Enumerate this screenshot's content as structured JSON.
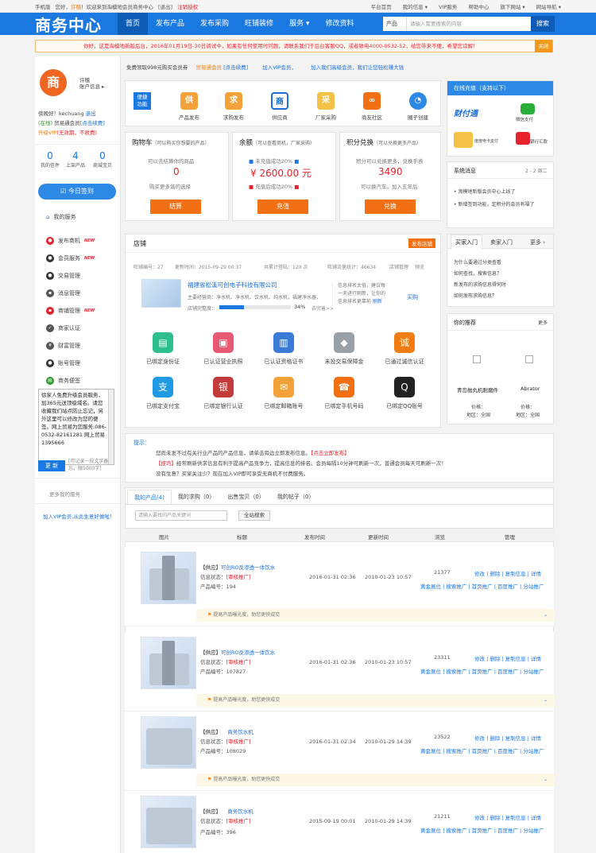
{
  "topbar": {
    "mobile": "手机版",
    "greet": "您好，",
    "user": "许稽",
    "welcome": "欢迎来到淘模地会员商务中心",
    "logout": "[退出]",
    "cancel": "注销授权",
    "links": [
      "平台首页",
      "我的信息 ▾",
      "VIP服务",
      "帮助中心",
      "旗下网站 ▾",
      "网站导航 ▾"
    ]
  },
  "nav": {
    "logo": "商务中心",
    "items": [
      "首页",
      "发布产品",
      "发布采购",
      "旺铺装修",
      "服务 ▾",
      "修改资料"
    ],
    "search_scope": "产品",
    "search_placeholder": "请输入需要搜索的内容",
    "search_btn": "搜索"
  },
  "notice": {
    "text": "你好，这是淘模地新版后台，2016年01月19日-30日调试中，如果有任何使用时问题，请联系我们于后台客服QQ，或者致电4000-0532-52，给您带来不便，希望您谅解！",
    "close": "关闭"
  },
  "profile": {
    "avatar": "商",
    "name": "许稽",
    "menu": "账户信息 ▸",
    "hello": "傍晚好！kechuang",
    "exit": "退出",
    "online": "(在线)",
    "level": "贸易通会员",
    "renew": "[点击续费]",
    "vip": "升级VIP",
    "noneline": "(无效期，不收费)",
    "stats": [
      {
        "n": "0",
        "t": "我的信件"
      },
      {
        "n": "4",
        "t": "上架产品"
      },
      {
        "n": "0",
        "t": "商城宝贝"
      }
    ],
    "sign": "今日签到",
    "myservice": "我的服务"
  },
  "menu": [
    {
      "label": "发布商机",
      "hot": "NEW"
    },
    {
      "label": "会员服务",
      "hot": "NEW"
    },
    {
      "label": "交易管理",
      "hot": ""
    },
    {
      "label": "消息管理",
      "hot": ""
    },
    {
      "label": "商铺管理",
      "hot": "NEW"
    },
    {
      "label": "商家认证",
      "hot": ""
    },
    {
      "label": "财富管理",
      "hot": ""
    },
    {
      "label": "账号管理",
      "hot": ""
    },
    {
      "label": "商务便签",
      "hot": ""
    }
  ],
  "memo": {
    "text": "徐家人免费升级会员服务，加365元送顶级域名。请您收藏我们站点防止忘记，另外这里可以修改为您的便签。网上贸易为您服务:086-0532-82161281 网上贸易 1395666",
    "update": "更 新",
    "hint": "[可记录一段文字备忘，限5000字]",
    "more": "更多我的服务",
    "vip_tip": "加入VIP会员,从此生意好做啦！"
  },
  "promo": {
    "a": "免费领取998元购买会员券",
    "b": "贸易通会员",
    "c": "[点击续费]",
    "d": "加入VIP会员，",
    "e": "加入我们高级会员，我们让您轻松赚大钱"
  },
  "quick": {
    "title": "便捷功能",
    "items": [
      {
        "label": "产品发布",
        "ch": "供",
        "color": "#f3a23a"
      },
      {
        "label": "求购发布",
        "ch": "求",
        "color": "#f3a23a"
      },
      {
        "label": "供应商",
        "ch": "商",
        "color": "#1a6fd8"
      },
      {
        "label": "厂家采购",
        "ch": "采",
        "color": "#f3c247"
      },
      {
        "label": "商友社区",
        "ch": "∞",
        "color": "#f36f14"
      },
      {
        "label": "圈子创建",
        "ch": "◔",
        "color": "#2d89e6"
      }
    ]
  },
  "cart": {
    "title": "购物车",
    "sub": "（可以购买你想要的产品）",
    "line1": "可以去结算你的商品",
    "num": "0",
    "line2": "购买更多谐的选择",
    "btn": "结算"
  },
  "balance": {
    "title": "余额",
    "sub": "（可以查看商机，厂家采购）",
    "a": "未充值成功20%",
    "amount": "¥ 2600.00 元",
    "b": "充值后成功20%",
    "btn": "充值"
  },
  "points": {
    "title": "积分兑换",
    "sub": "（可以兑换更多产品）",
    "line1": "积分可以兑换更多，兑换手表",
    "num": "3490",
    "line2": "可以换汽车，加入五年后",
    "btn": "兑换"
  },
  "shop": {
    "title": "店铺",
    "btn": "发布店铺",
    "info": [
      "旺铺编号：27",
      "更新时间：2015-09-29 00:37",
      "共累计登陆：120 次",
      "旺铺流量统计：46634",
      "店铺管理",
      "预览"
    ],
    "company": "福建省松溪可创电子科技有限公司",
    "main": "主要经营商：净水机、净水机、饮水机、纯水机，福建净水器，",
    "progress_label": "店铺完整度：",
    "progress": "34%",
    "progress_val": 34,
    "improve": "去完善>>",
    "rank": "信息排名太低，建议每一天进行刷新，让你的信息排名更靠前",
    "refresh": "刷新",
    "buy": "买购"
  },
  "certs": [
    {
      "label": "已绑定身份证",
      "color": "#2fbf8f",
      "ch": "▤"
    },
    {
      "label": "已认证营业执照",
      "color": "#e85a73",
      "ch": "▣"
    },
    {
      "label": "已认证资格证书",
      "color": "#3a7bd8",
      "ch": "▥"
    },
    {
      "label": "未投交易保障金",
      "color": "#9aa0a8",
      "ch": "◆"
    },
    {
      "label": "已通过诚信认证",
      "color": "#f07d12",
      "ch": "诚"
    },
    {
      "label": "已绑定支付宝",
      "color": "#1f9be6",
      "ch": "支"
    },
    {
      "label": "已绑定银行认证",
      "color": "#c23a3a",
      "ch": "银"
    },
    {
      "label": "已绑定邮箱账号",
      "color": "#f3a23a",
      "ch": "✉"
    },
    {
      "label": "已绑定手机号码",
      "color": "#f36f14",
      "ch": "☎"
    },
    {
      "label": "已绑定QQ账号",
      "color": "#222222",
      "ch": "Q"
    }
  ],
  "tips": {
    "title": "提示：",
    "l1": "您尚未发不过有关行业产品的产品信息，请单击旁边立即发布信息。",
    "l1b": "【点击立即发布】",
    "l2a": "【技巧】",
    "l2": "经常刷新供求信息有利于提高产品竞争力，提高信息的排名。会员每隔10分钟可刷新一次，普通会员每天可刷新一次！",
    "l3": "没有生意？买家关注少？现在加入VIP即可享受无商机不付费服务。"
  },
  "ptabs": [
    "我的产品(4)",
    "我的求购（0）",
    "出售宝贝（0）",
    "我的帖子（0）"
  ],
  "psearch": {
    "placeholder": "请输入要找的产品关键词",
    "btn": "全站搜索"
  },
  "thead": [
    "图片",
    "标题",
    "发布时间",
    "更新时间",
    "浏览",
    "管理"
  ],
  "products": [
    {
      "tag": "【供应】",
      "name": "可创RO反渗透一体饮水",
      "status": "信息状态：",
      "st": "[审核推广]",
      "code": "产品编号：194",
      "pub": "2016-01-31 02:36",
      "upd": "2010-01-23 10:57",
      "views": "21377"
    },
    {
      "tag": "【供应】",
      "name": "可创RO反渗透一体饮水",
      "status": "信息状态：",
      "st": "[审核推广]",
      "code": "产品编号：107827",
      "pub": "2016-01-31 02:36",
      "upd": "2010-01-23 10:57",
      "views": "23311"
    },
    {
      "tag": "【供应】",
      "name": "商务饮水机",
      "status": "信息状态：",
      "st": "[审核推广]",
      "code": "产品编号：108029",
      "pub": "2016-01-31 02:34",
      "upd": "2010-01-29 14:39",
      "views": "23522"
    },
    {
      "tag": "【供应】",
      "name": "商务饮水机",
      "status": "信息状态：",
      "st": "[审核推广]",
      "code": "产品编号：396",
      "pub": "2015-09-19 00:01",
      "upd": "2010-01-29 14:39",
      "views": "21211"
    }
  ],
  "actions": {
    "a": [
      "修改",
      "删除",
      "复制信息",
      "详情"
    ],
    "b": [
      "黄金展位",
      "搜索推广",
      "首页推广",
      "百度推广",
      "分站推广"
    ]
  },
  "rowtip": "提高产品曝光度，助您更快成交",
  "right": {
    "pay_title": "在线充值（支持以下）",
    "pays": [
      "财付通",
      "微信支付",
      "度度电卡支付",
      "银行汇款"
    ],
    "sys_title": "系统消息",
    "sys_page": "2 - 2 周二",
    "sys": [
      "淘模地新版会员中心上线了",
      "新增签到功能，定积分的会员有福了"
    ],
    "guide_tabs": [
      "买家入门",
      "卖家入门",
      "更多 ›"
    ],
    "guide": [
      "为什么要通过分类查看",
      "如何查找，搜索信息？",
      "新发布的求购信息得何时",
      "如何发布求购信息？"
    ],
    "rec_title": "你的推荐",
    "rec_more": "更多",
    "recs": [
      {
        "name": "青岛抛丸机耐磨件",
        "price": "价格：",
        "area": "地区：全国"
      },
      {
        "name": "Abrator",
        "price": "价格：",
        "area": "地区：全国"
      }
    ]
  }
}
